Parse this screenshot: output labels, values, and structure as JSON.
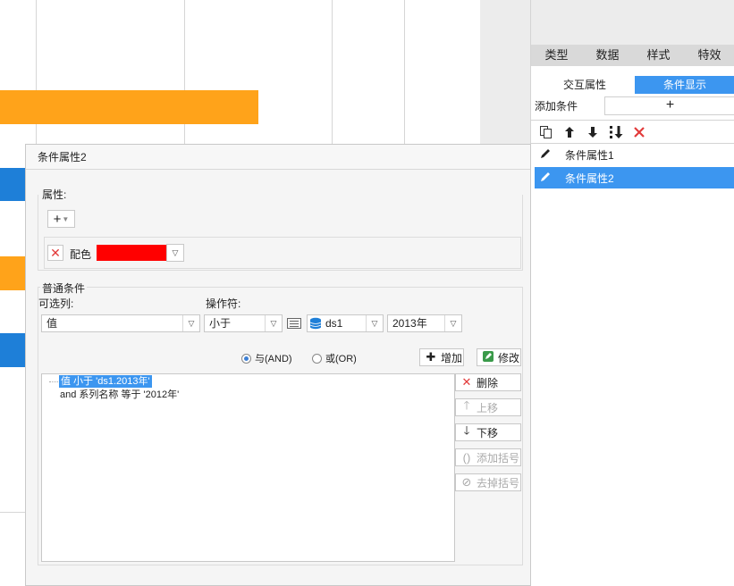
{
  "colors": {
    "orange": "#ffa31a",
    "blue": "#1e7fd8",
    "accent": "#3c96f0",
    "red_swatch": "#ff0000",
    "delete_red": "#e23a3a"
  },
  "panel": {
    "tabs": [
      "类型",
      "数据",
      "样式",
      "特效"
    ],
    "subtabs": [
      "交互属性",
      "条件显示"
    ],
    "add_condition_label": "添加条件",
    "add_condition_symbol": "+",
    "toolbar_icons": [
      "copy-icon",
      "arrow-up-icon",
      "arrow-down-icon",
      "sort-icon",
      "delete-icon"
    ],
    "conditions": [
      {
        "label": "条件属性1",
        "icon": "pencil-icon",
        "selected": false
      },
      {
        "label": "条件属性2",
        "icon": "pencil-icon",
        "selected": true
      }
    ]
  },
  "dialog": {
    "title": "条件属性2",
    "attributes_label": "属性:",
    "add_attr_symbol": "+",
    "color_label": "配色",
    "general_label": "普通条件",
    "optional_column_label": "可选列:",
    "operator_label": "操作符:",
    "column_value": "值",
    "operator_value": "小于",
    "dataset_value": "ds1",
    "field_value": "2013年",
    "and_label": "与(AND)",
    "or_label": "或(OR)",
    "add_button": "增加",
    "modify_button": "修改",
    "delete_button": "删除",
    "move_up_button": "上移",
    "move_down_button": "下移",
    "add_bracket_button": "添加括号",
    "remove_bracket_button": "去掉括号",
    "condition_lines": [
      "值 小于 'ds1.2013年'",
      "and 系列名称 等于 '2012年'"
    ]
  }
}
